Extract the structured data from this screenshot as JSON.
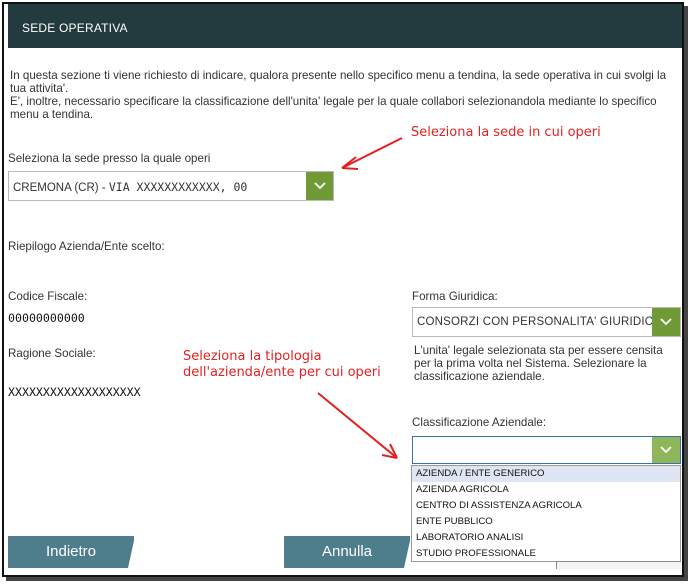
{
  "header": {
    "title": "SEDE OPERATIVA"
  },
  "intro": {
    "line1": "In questa sezione ti viene richiesto di indicare, qualora presente nello specifico menu a tendina, la sede operativa in cui svolgi la tua attivita'.",
    "line2": "E', inoltre, necessario specificare la classificazione dell'unita' legale per la quale collabori selezionandola mediante lo specifico menu a tendina."
  },
  "annotations": {
    "sede_hint": "Seleziona la sede in cui operi",
    "tipologia_hint": "Seleziona la tipologia dell'azienda/ente per cui operi"
  },
  "sede": {
    "label": "Seleziona la sede presso la quale operi",
    "value_prefix": "CREMONA (CR) - ",
    "value_address": "VIA XXXXXXXXXXXX, 00"
  },
  "riepilogo": {
    "title": "Riepilogo Azienda/Ente scelto:"
  },
  "codice_fiscale": {
    "label": "Codice Fiscale:",
    "value": "00000000000"
  },
  "ragione_sociale": {
    "label": "Ragione Sociale:",
    "value": "XXXXXXXXXXXXXXXXXXX"
  },
  "forma_giuridica": {
    "label": "Forma Giuridica:",
    "value": "CONSORZI CON PERSONALITA' GIURIDICA"
  },
  "note": "L'unita' legale selezionata sta per essere censita per la prima volta nel Sistema. Selezionare la classificazione aziendale.",
  "classificazione": {
    "label": "Classificazione Aziendale:",
    "value": "",
    "options": [
      "Azienda / Ente generico",
      "Azienda agricola",
      "Centro di assistenza agricola",
      "Ente pubblico",
      "Laboratorio analisi",
      "Studio professionale"
    ],
    "highlighted_index": 0
  },
  "buttons": {
    "back": "Indietro",
    "cancel": "Annulla"
  },
  "colors": {
    "header": "#233a3f",
    "button": "#4e7d8c",
    "chevron": "#6f9a36",
    "annotation": "#e32020"
  }
}
